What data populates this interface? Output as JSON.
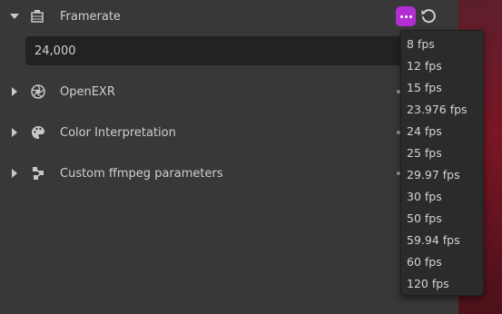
{
  "framerate": {
    "label": "Framerate",
    "value": "24,000",
    "icon": "film-icon",
    "expanded": true
  },
  "sections": [
    {
      "label": "OpenEXR",
      "icon": "aperture-icon",
      "expanded": false
    },
    {
      "label": "Color Interpretation",
      "icon": "palette-icon",
      "expanded": false
    },
    {
      "label": "Custom ffmpeg parameters",
      "icon": "node-tree-icon",
      "expanded": false
    }
  ],
  "presets_menu": {
    "items": [
      "8 fps",
      "12 fps",
      "15 fps",
      "23.976 fps",
      "24 fps",
      "25 fps",
      "29.97 fps",
      "30 fps",
      "50 fps",
      "59.94 fps",
      "60 fps",
      "120 fps"
    ]
  },
  "colors": {
    "accent": "#b02fd0",
    "panel_bg": "#383838",
    "field_bg": "#222222",
    "menu_bg": "#2b2b2b"
  }
}
